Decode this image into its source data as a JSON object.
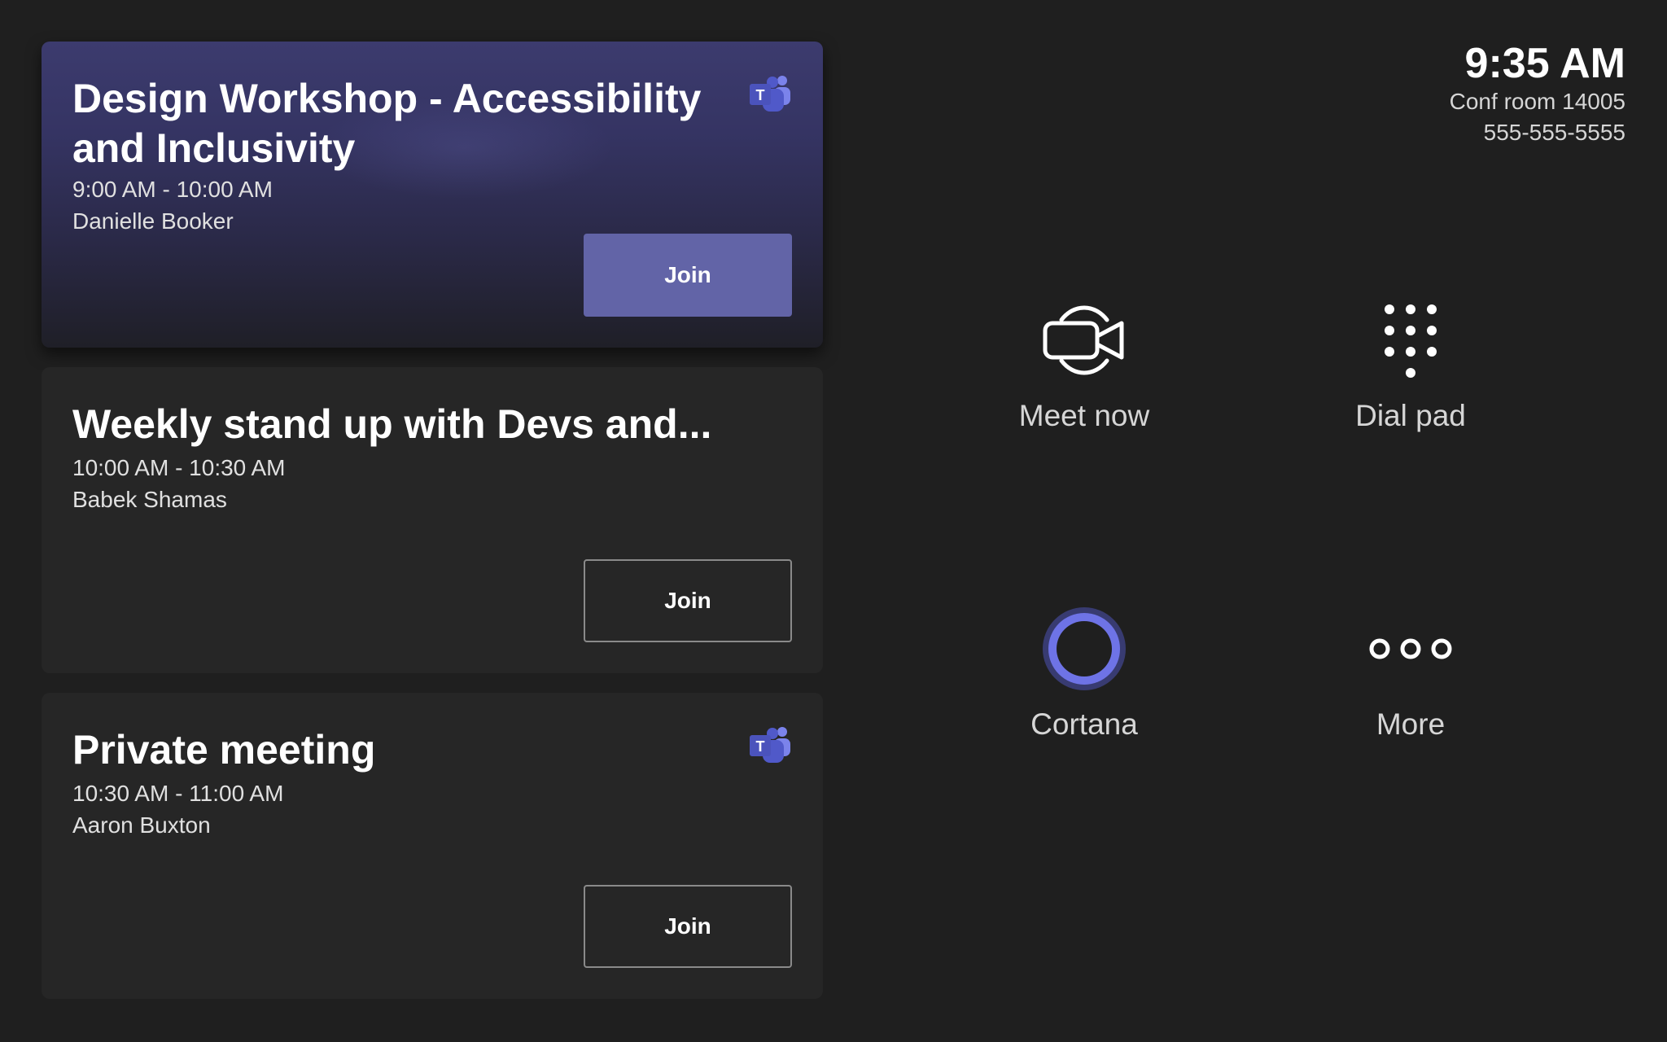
{
  "meetings": [
    {
      "title": "Design Workshop - Accessibility and Inclusivity",
      "time": "9:00 AM - 10:00 AM",
      "organizer": "Danielle Booker",
      "join_label": "Join",
      "teams_badge_letter": "T"
    },
    {
      "title": "Weekly stand up with Devs and...",
      "time": "10:00 AM - 10:30 AM",
      "organizer": "Babek Shamas",
      "join_label": "Join"
    },
    {
      "title": "Private meeting",
      "time": "10:30 AM - 11:00 AM",
      "organizer": "Aaron Buxton",
      "join_label": "Join",
      "teams_badge_letter": "T"
    }
  ],
  "header": {
    "clock": "9:35 AM",
    "room_name": "Conf room 14005",
    "room_phone": "555-555-5555"
  },
  "actions": [
    {
      "label": "Meet now",
      "icon": "video-camera-icon"
    },
    {
      "label": "Dial pad",
      "icon": "dial-pad-icon"
    },
    {
      "label": "Cortana",
      "icon": "cortana-icon"
    },
    {
      "label": "More",
      "icon": "more-icon"
    }
  ],
  "colors": {
    "background": "#1f1f1f",
    "card": "#262626",
    "accent": "#6264a7",
    "cortana": "#6e73e6"
  }
}
